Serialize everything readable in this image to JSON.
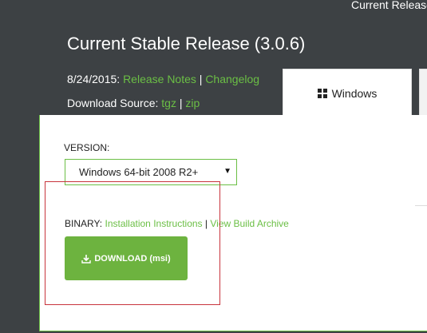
{
  "header": {
    "top_link": "Current Release",
    "title": "Current Stable Release (3.0.6)",
    "date": "8/24/2015:",
    "release_notes": "Release Notes",
    "changelog": "Changelog",
    "download_source_label": "Download Source:",
    "tgz": "tgz",
    "zip": "zip",
    "separator": "|"
  },
  "tabs": [
    {
      "label": "Windows",
      "icon": "windows-icon",
      "selected": true
    }
  ],
  "panel": {
    "version_label": "VERSION:",
    "version_selected": "Windows 64-bit 2008 R2+",
    "binary_label": "BINARY:",
    "installation_instructions": "Installation Instructions",
    "view_build_archive": "View Build Archive",
    "download_button": "DOWNLOAD (msi)",
    "download_icon": "download-icon"
  },
  "colors": {
    "background": "#3d4144",
    "accent_green": "#6bbf45",
    "button_green": "#6db33f",
    "annotation_red": "#c8343c"
  }
}
